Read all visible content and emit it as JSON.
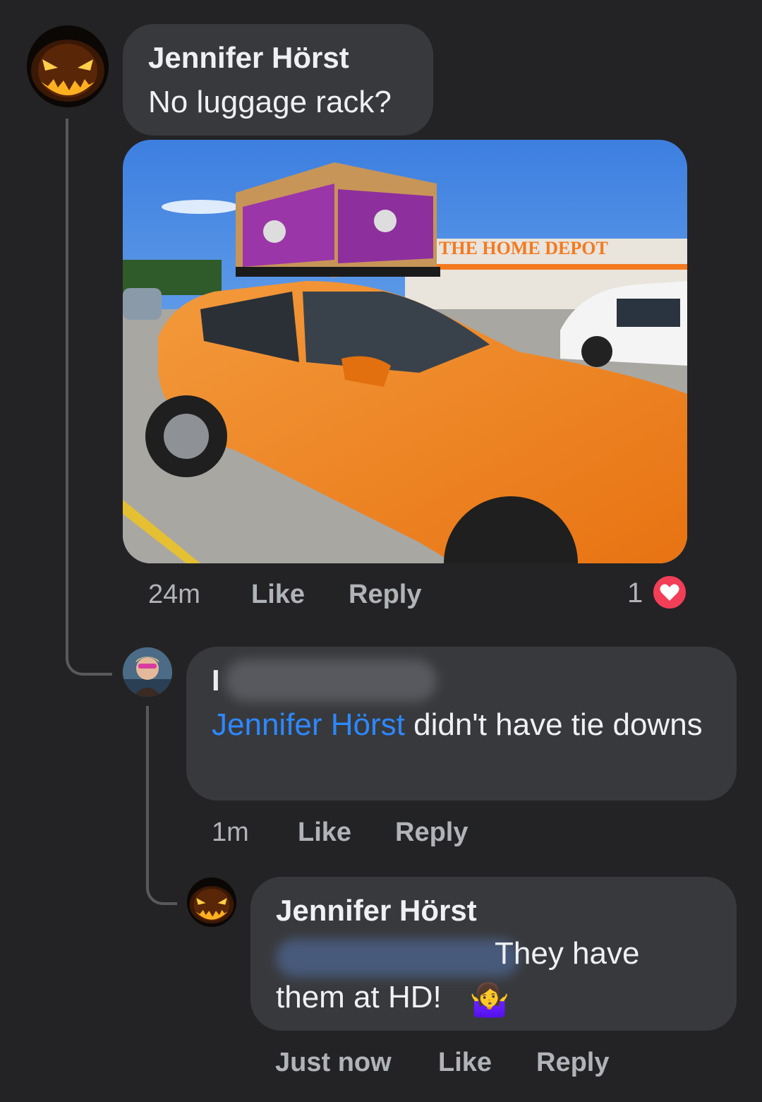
{
  "comment1": {
    "author": "Jennifer Hörst",
    "text": "No luggage rack?",
    "time": "24m",
    "like": "Like",
    "reply": "Reply",
    "reaction_count": "1",
    "reaction_icon": "heart-icon",
    "photo_sign": "THE HOME DEPOT"
  },
  "comment2": {
    "author_visible": "I",
    "mention": "Jennifer Hörst",
    "text": " didn't have tie downs",
    "time": "1m",
    "like": "Like",
    "reply": "Reply"
  },
  "comment3": {
    "author": "Jennifer Hörst",
    "text_line1": "They have",
    "text_line2": "them at HD!",
    "emoji": "🤷‍♀️",
    "time": "Just now",
    "like": "Like",
    "reply": "Reply"
  },
  "colors": {
    "background": "#232325",
    "bubble": "#38393c",
    "mention": "#2d88ff",
    "reaction": "#f33e58"
  }
}
